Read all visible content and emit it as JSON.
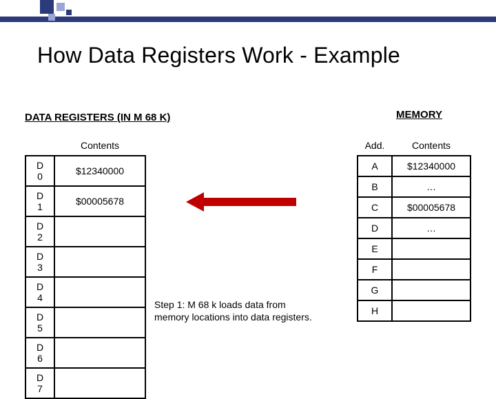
{
  "title": "How Data Registers Work - Example",
  "left": {
    "heading": "DATA REGISTERS (IN M 68 K)",
    "col_contents": "Contents",
    "rows": [
      {
        "reg": "D 0",
        "val": "$12340000"
      },
      {
        "reg": "D 1",
        "val": "$00005678"
      },
      {
        "reg": "D 2",
        "val": ""
      },
      {
        "reg": "D 3",
        "val": ""
      },
      {
        "reg": "D 4",
        "val": ""
      },
      {
        "reg": "D 5",
        "val": ""
      },
      {
        "reg": "D 6",
        "val": ""
      },
      {
        "reg": "D 7",
        "val": ""
      }
    ]
  },
  "right": {
    "heading": "MEMORY",
    "col_add": "Add.",
    "col_contents": "Contents",
    "rows": [
      {
        "add": "A",
        "val": "$12340000"
      },
      {
        "add": "B",
        "val": "…"
      },
      {
        "add": "C",
        "val": "$00005678"
      },
      {
        "add": "D",
        "val": "…"
      },
      {
        "add": "E",
        "val": ""
      },
      {
        "add": "F",
        "val": ""
      },
      {
        "add": "G",
        "val": ""
      },
      {
        "add": "H",
        "val": ""
      }
    ]
  },
  "step_text": "Step 1: M 68 k loads data from memory locations into data registers."
}
